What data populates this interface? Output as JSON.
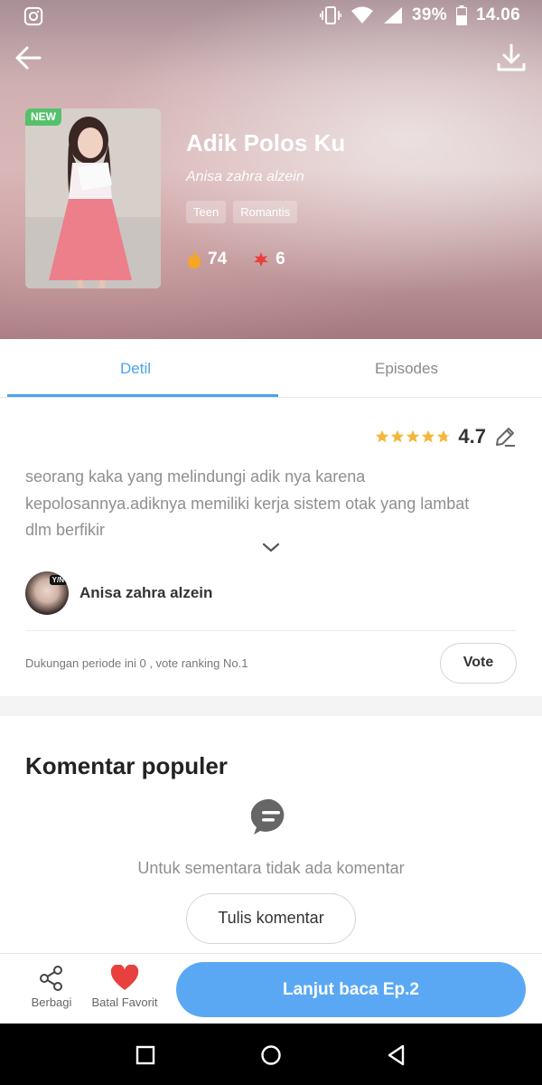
{
  "status_bar": {
    "battery": "39%",
    "time": "14.06",
    "left_icon": "instagram-icon",
    "right_icons": [
      "vibrate-icon",
      "wifi-icon",
      "signal-icon",
      "battery-icon"
    ]
  },
  "header": {
    "back_icon": "arrow-left-icon",
    "download_icon": "download-icon"
  },
  "book": {
    "badge": "NEW",
    "title": "Adik Polos Ku",
    "author": "Anisa zahra alzein",
    "tags": [
      "Teen",
      "Romantis"
    ],
    "stats": {
      "fire_count": "74",
      "favorite_count": "6"
    }
  },
  "tabs": [
    {
      "label": "Detil",
      "active": true
    },
    {
      "label": "Episodes",
      "active": false
    }
  ],
  "details": {
    "rating": "4.7",
    "stars_filled": 4.7,
    "description": "seorang kaka yang melindungi adik nya karena kepolosannya.adiknya memiliki kerja sistem otak yang lambat dlm berfikir",
    "author_name": "Anisa zahra alzein",
    "avatar_badge": "Y/N",
    "support_text": "Dukungan periode ini 0 , vote ranking No.1",
    "vote_label": "Vote"
  },
  "comments": {
    "title": "Komentar populer",
    "empty_text": "Untuk sementara tidak ada komentar",
    "write_label": "Tulis komentar"
  },
  "action_bar": {
    "share_label": "Berbagi",
    "favorite_label": "Batal Favorit",
    "continue_label": "Lanjut baca Ep.2"
  },
  "colors": {
    "accent": "#4aa3f0",
    "primary_button": "#5aa8f4",
    "new_badge": "#55c16b",
    "star": "#f5b63a",
    "heart": "#e8403e"
  }
}
